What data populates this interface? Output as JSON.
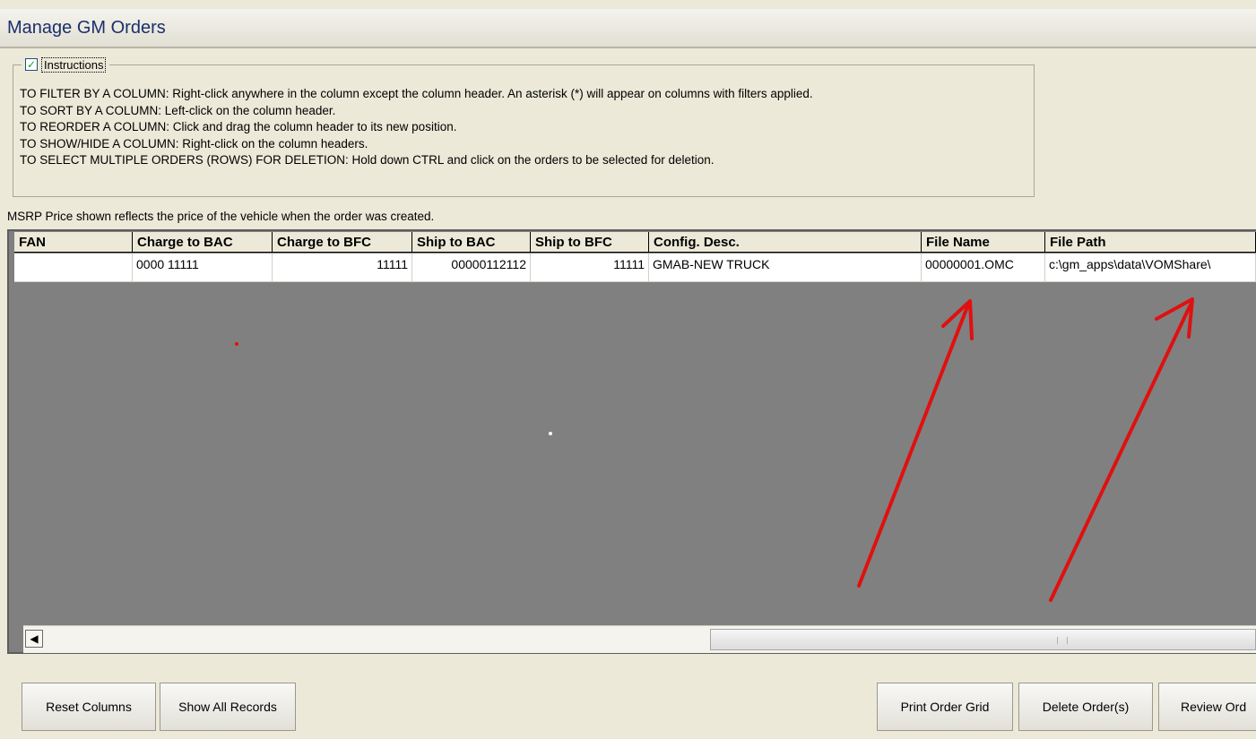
{
  "window": {
    "title": "Manage GM Orders"
  },
  "instructions": {
    "label": "Instructions",
    "checked": true,
    "lines": [
      "TO FILTER BY A COLUMN:  Right-click anywhere in the column except the column header. An asterisk (*) will appear on columns with filters applied.",
      "TO SORT BY A COLUMN:  Left-click on the column header.",
      "TO REORDER A COLUMN:  Click and drag the column header to its new position.",
      "TO SHOW/HIDE A COLUMN:  Right-click on the column headers.",
      "TO SELECT MULTIPLE ORDERS (ROWS) FOR DELETION:  Hold down CTRL and click on the orders to be selected for deletion."
    ]
  },
  "msrp_note": "MSRP Price shown reflects the price of the vehicle when the order was created.",
  "grid": {
    "columns": [
      "FAN",
      "Charge to BAC",
      "Charge to BFC",
      "Ship to BAC",
      "Ship to BFC",
      "Config. Desc.",
      "File Name",
      "File Path"
    ],
    "rows": [
      [
        "",
        "0000 11111",
        "11111",
        "00000112112",
        "11111",
        "GMAB-NEW TRUCK",
        "00000001.OMC",
        "c:\\gm_apps\\data\\VOMShare\\"
      ]
    ]
  },
  "buttons": {
    "reset_columns": "Reset Columns",
    "show_all_records": "Show All Records",
    "print_order_grid": "Print Order Grid",
    "delete_orders": "Delete Order(s)",
    "review_order": "Review Ord"
  },
  "colors": {
    "annotation_arrow": "#e01010",
    "grid_background": "#808080"
  }
}
